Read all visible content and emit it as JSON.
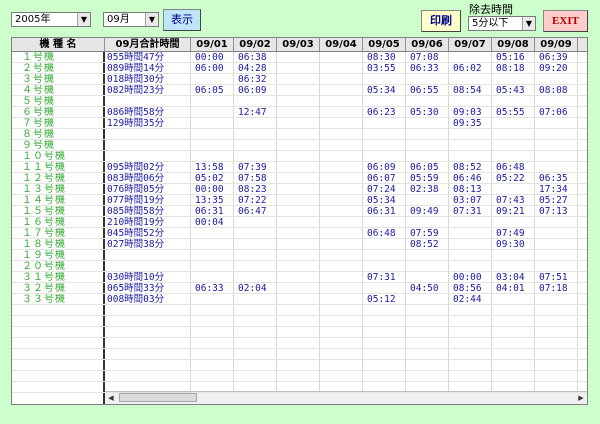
{
  "year_select": {
    "value": "2005年"
  },
  "month_select": {
    "value": "09月"
  },
  "show_button": {
    "label": "表示"
  },
  "print_button": {
    "label": "印刷"
  },
  "exclude": {
    "label": "除去時間",
    "value": "5分以下"
  },
  "exit_button": {
    "label": "EXIT"
  },
  "grid": {
    "name_header": "機 種 名",
    "total_header": "09月合計時間",
    "date_headers": [
      "09/01",
      "09/02",
      "09/03",
      "09/04",
      "09/05",
      "09/06",
      "09/07",
      "09/08",
      "09/09"
    ],
    "rows": [
      {
        "name": "１号機",
        "total": "055時間47分",
        "cells": [
          "00:00",
          "06:38",
          "",
          "",
          "08:30",
          "07:08",
          "",
          "05:16",
          "06:39"
        ]
      },
      {
        "name": "２号機",
        "total": "089時間14分",
        "cells": [
          "06:00",
          "04:28",
          "",
          "",
          "03:55",
          "06:33",
          "06:02",
          "08:18",
          "09:20"
        ]
      },
      {
        "name": "３号機",
        "total": "018時間30分",
        "cells": [
          "",
          "06:32",
          "",
          "",
          "",
          "",
          "",
          "",
          ""
        ]
      },
      {
        "name": "４号機",
        "total": "082時間23分",
        "cells": [
          "06:05",
          "06:09",
          "",
          "",
          "05:34",
          "06:55",
          "08:54",
          "05:43",
          "08:08"
        ]
      },
      {
        "name": "５号機",
        "total": "",
        "cells": [
          "",
          "",
          "",
          "",
          "",
          "",
          "",
          "",
          ""
        ]
      },
      {
        "name": "６号機",
        "total": "086時間58分",
        "cells": [
          "",
          "12:47",
          "",
          "",
          "06:23",
          "05:30",
          "09:03",
          "05:55",
          "07:06"
        ]
      },
      {
        "name": "７号機",
        "total": "129時間35分",
        "cells": [
          "",
          "",
          "",
          "",
          "",
          "",
          "09:35",
          "",
          ""
        ]
      },
      {
        "name": "８号機",
        "total": "",
        "cells": [
          "",
          "",
          "",
          "",
          "",
          "",
          "",
          "",
          ""
        ]
      },
      {
        "name": "９号機",
        "total": "",
        "cells": [
          "",
          "",
          "",
          "",
          "",
          "",
          "",
          "",
          ""
        ]
      },
      {
        "name": "１０号機",
        "total": "",
        "cells": [
          "",
          "",
          "",
          "",
          "",
          "",
          "",
          "",
          ""
        ]
      },
      {
        "name": "１１号機",
        "total": "095時間02分",
        "cells": [
          "13:58",
          "07:39",
          "",
          "",
          "06:09",
          "06:05",
          "08:52",
          "06:48",
          ""
        ]
      },
      {
        "name": "１２号機",
        "total": "083時間06分",
        "cells": [
          "05:02",
          "07:58",
          "",
          "",
          "06:07",
          "05:59",
          "06:46",
          "05:22",
          "06:35"
        ]
      },
      {
        "name": "１３号機",
        "total": "076時間05分",
        "cells": [
          "00:00",
          "08:23",
          "",
          "",
          "07:24",
          "02:38",
          "08:13",
          "",
          "17:34"
        ]
      },
      {
        "name": "１４号機",
        "total": "077時間19分",
        "cells": [
          "13:35",
          "07:22",
          "",
          "",
          "05:34",
          "",
          "03:07",
          "07:43",
          "05:27"
        ]
      },
      {
        "name": "１５号機",
        "total": "085時間58分",
        "cells": [
          "06:31",
          "06:47",
          "",
          "",
          "06:31",
          "09:49",
          "07:31",
          "09:21",
          "07:13"
        ]
      },
      {
        "name": "１６号機",
        "total": "210時間19分",
        "cells": [
          "00:04",
          "",
          "",
          "",
          "",
          "",
          "",
          "",
          ""
        ]
      },
      {
        "name": "１７号機",
        "total": "045時間52分",
        "cells": [
          "",
          "",
          "",
          "",
          "06:48",
          "07:59",
          "",
          "07:49",
          ""
        ]
      },
      {
        "name": "１８号機",
        "total": "027時間38分",
        "cells": [
          "",
          "",
          "",
          "",
          "",
          "08:52",
          "",
          "09:30",
          ""
        ]
      },
      {
        "name": "１９号機",
        "total": "",
        "cells": [
          "",
          "",
          "",
          "",
          "",
          "",
          "",
          "",
          ""
        ]
      },
      {
        "name": "２０号機",
        "total": "",
        "cells": [
          "",
          "",
          "",
          "",
          "",
          "",
          "",
          "",
          ""
        ]
      },
      {
        "name": "３１号機",
        "total": "030時間10分",
        "cells": [
          "",
          "",
          "",
          "",
          "07:31",
          "",
          "00:00",
          "03:04",
          "07:51"
        ]
      },
      {
        "name": "３２号機",
        "total": "065時間33分",
        "cells": [
          "06:33",
          "02:04",
          "",
          "",
          "",
          "04:50",
          "08:56",
          "04:01",
          "07:18"
        ]
      },
      {
        "name": "３３号機",
        "total": "008時間03分",
        "cells": [
          "",
          "",
          "",
          "",
          "05:12",
          "",
          "02:44",
          "",
          ""
        ]
      }
    ]
  }
}
